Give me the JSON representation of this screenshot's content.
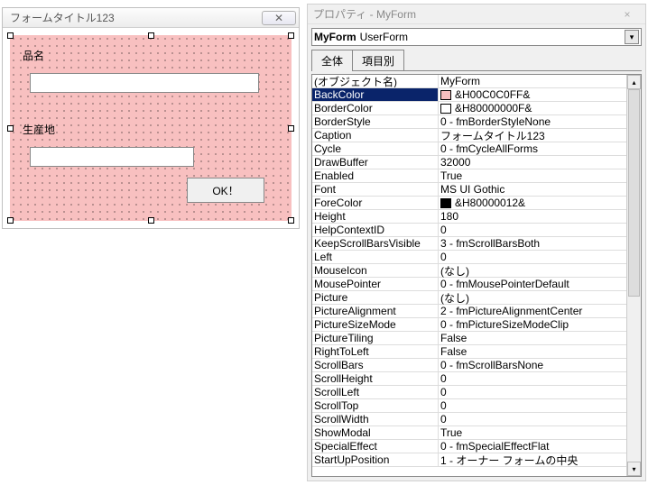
{
  "form": {
    "title": "フォームタイトル123",
    "close_glyph": "✕",
    "label1": "品名",
    "label2": "生産地",
    "button_ok": "OK！"
  },
  "props": {
    "panel_title": "プロパティ - MyForm",
    "combo_name": "MyForm",
    "combo_type": "UserForm",
    "tab_all": "全体",
    "tab_cat": "項目別",
    "rows": [
      {
        "name": "(オブジェクト名)",
        "val": "MyForm"
      },
      {
        "name": "BackColor",
        "val": "&H00C0C0FF&",
        "swatch": "#f8c0c0",
        "sel": true
      },
      {
        "name": "BorderColor",
        "val": "&H80000000F&",
        "swatch": "#ffffff"
      },
      {
        "name": "BorderStyle",
        "val": "0 - fmBorderStyleNone"
      },
      {
        "name": "Caption",
        "val": "フォームタイトル123"
      },
      {
        "name": "Cycle",
        "val": "0 - fmCycleAllForms"
      },
      {
        "name": "DrawBuffer",
        "val": "32000"
      },
      {
        "name": "Enabled",
        "val": "True"
      },
      {
        "name": "Font",
        "val": "MS UI Gothic"
      },
      {
        "name": "ForeColor",
        "val": "&H80000012&",
        "swatch": "#000000"
      },
      {
        "name": "Height",
        "val": "180"
      },
      {
        "name": "HelpContextID",
        "val": "0"
      },
      {
        "name": "KeepScrollBarsVisible",
        "val": "3 - fmScrollBarsBoth"
      },
      {
        "name": "Left",
        "val": "0"
      },
      {
        "name": "MouseIcon",
        "val": "(なし)"
      },
      {
        "name": "MousePointer",
        "val": "0 - fmMousePointerDefault"
      },
      {
        "name": "Picture",
        "val": "(なし)"
      },
      {
        "name": "PictureAlignment",
        "val": "2 - fmPictureAlignmentCenter"
      },
      {
        "name": "PictureSizeMode",
        "val": "0 - fmPictureSizeModeClip"
      },
      {
        "name": "PictureTiling",
        "val": "False"
      },
      {
        "name": "RightToLeft",
        "val": "False"
      },
      {
        "name": "ScrollBars",
        "val": "0 - fmScrollBarsNone"
      },
      {
        "name": "ScrollHeight",
        "val": "0"
      },
      {
        "name": "ScrollLeft",
        "val": "0"
      },
      {
        "name": "ScrollTop",
        "val": "0"
      },
      {
        "name": "ScrollWidth",
        "val": "0"
      },
      {
        "name": "ShowModal",
        "val": "True"
      },
      {
        "name": "SpecialEffect",
        "val": "0 - fmSpecialEffectFlat"
      },
      {
        "name": "StartUpPosition",
        "val": "1 - オーナー フォームの中央"
      }
    ]
  }
}
